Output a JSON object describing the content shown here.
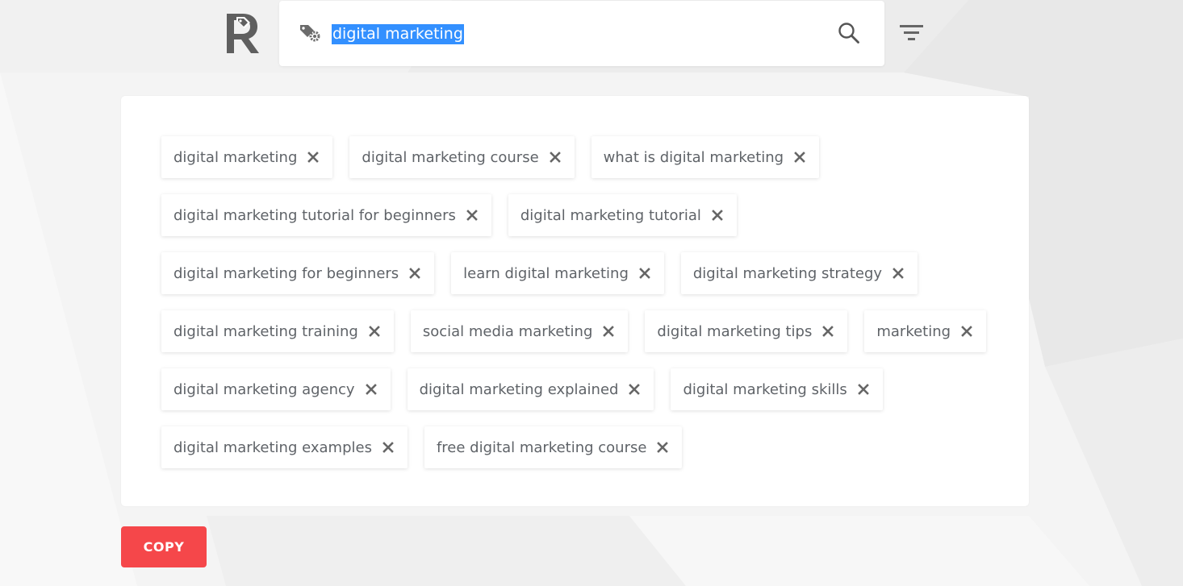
{
  "search": {
    "query": "digital marketing"
  },
  "tags": [
    "digital marketing",
    "digital marketing course",
    "what is digital marketing",
    "digital marketing tutorial for beginners",
    "digital marketing tutorial",
    "digital marketing for beginners",
    "learn digital marketing",
    "digital marketing strategy",
    "digital marketing training",
    "social media marketing",
    "digital marketing tips",
    "marketing",
    "digital marketing agency",
    "digital marketing explained",
    "digital marketing skills",
    "digital marketing examples",
    "free digital marketing course"
  ],
  "actions": {
    "copy_label": "COPY"
  },
  "icons": {
    "logo": "rapidtags-logo",
    "tag": "tag-gear-icon",
    "search": "search-icon",
    "filter": "filter-icon",
    "remove": "close-icon"
  },
  "colors": {
    "accent": "#f5474a",
    "selection": "#3390ff",
    "tag_text": "#5f6368",
    "icon": "#6b6b6b"
  }
}
